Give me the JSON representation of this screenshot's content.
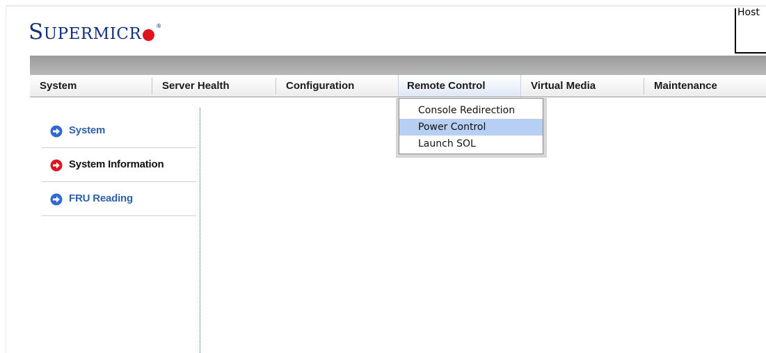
{
  "header": {
    "logo": {
      "first_letter": "S",
      "rest": "UPERMICR",
      "registered": "®"
    },
    "host_label": "Host"
  },
  "nav": {
    "items": [
      {
        "label": "System"
      },
      {
        "label": "Server Health"
      },
      {
        "label": "Configuration"
      },
      {
        "label": "Remote Control",
        "active": true
      },
      {
        "label": "Virtual Media"
      },
      {
        "label": "Maintenance"
      }
    ]
  },
  "dropdown": {
    "items": [
      {
        "label": "Console Redirection"
      },
      {
        "label": "Power Control",
        "highlighted": true
      },
      {
        "label": "Launch SOL"
      }
    ]
  },
  "sidebar": {
    "items": [
      {
        "label": "System",
        "icon": "arrow-right-circle-icon",
        "icon_color": "#2f6ad0"
      },
      {
        "label": "System Information",
        "icon": "arrow-right-circle-icon",
        "icon_color": "#e0141c"
      },
      {
        "label": "FRU Reading",
        "icon": "arrow-right-circle-icon",
        "icon_color": "#2f6ad0"
      }
    ]
  },
  "colors": {
    "brand_blue": "#13317a",
    "brand_red": "#e0141c",
    "menu_highlight": "#b6cff3",
    "link_blue": "#2f5fa8"
  }
}
